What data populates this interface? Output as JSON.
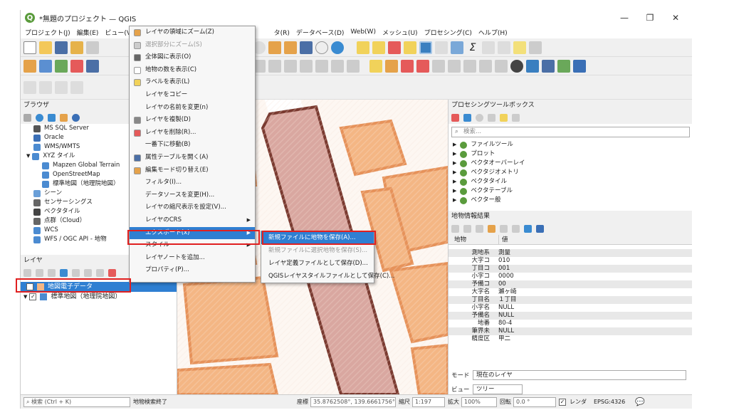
{
  "window": {
    "title": "*無題のプロジェクト — QGIS",
    "controls": [
      "—",
      "❐",
      "✕"
    ]
  },
  "menubar": [
    "プロジェクト(J)",
    "編集(E)",
    "ビュー(V)",
    "レイ",
    "タ(R)",
    "データベース(D)",
    "Web(W)",
    "メッシュ(U)",
    "プロセシング(C)",
    "ヘルプ(H)"
  ],
  "browser": {
    "title": "ブラウザ",
    "items": [
      {
        "label": "MS SQL Server",
        "indent": 1,
        "icon": "mssql-icon",
        "color": "#555"
      },
      {
        "label": "Oracle",
        "indent": 1,
        "icon": "oracle-icon",
        "color": "#3b6fb6"
      },
      {
        "label": "WMS/WMTS",
        "indent": 1,
        "icon": "globe-icon",
        "color": "#4b8bd1"
      },
      {
        "label": "XYZ タイル",
        "indent": 0,
        "icon": "grid-icon",
        "color": "#4b8bd1"
      },
      {
        "label": "Mapzen Global Terrain",
        "indent": 2,
        "icon": "grid-icon",
        "color": "#4b8bd1"
      },
      {
        "label": "OpenStreetMap",
        "indent": 2,
        "icon": "grid-icon",
        "color": "#4b8bd1"
      },
      {
        "label": "標準地図（地理院地図）",
        "indent": 2,
        "icon": "grid-icon",
        "color": "#4b8bd1"
      },
      {
        "label": "シーン",
        "indent": 1,
        "icon": "scene-icon",
        "color": "#6a9fd8"
      },
      {
        "label": "センサーシングス",
        "indent": 1,
        "icon": "sensor-icon",
        "color": "#666"
      },
      {
        "label": "ベクタタイル",
        "indent": 1,
        "icon": "vectortile-icon",
        "color": "#444"
      },
      {
        "label": "点群（Cloud）",
        "indent": 1,
        "icon": "pointcloud-icon",
        "color": "#666"
      },
      {
        "label": "WCS",
        "indent": 1,
        "icon": "globe-icon",
        "color": "#4b8bd1"
      },
      {
        "label": "WFS / OGC API - 地物",
        "indent": 1,
        "icon": "globe-icon",
        "color": "#4b8bd1"
      }
    ]
  },
  "layers": {
    "title": "レイヤ",
    "items": [
      {
        "label": "地図電子データ",
        "checked": true,
        "selected": true
      },
      {
        "label": "標準地図（地理院地図）",
        "checked": true,
        "selected": false
      }
    ]
  },
  "context_menu": {
    "items": [
      {
        "label": "レイヤの領域にズーム(Z)",
        "disabled": false,
        "icon": "zoom-layer-icon"
      },
      {
        "label": "選択部分にズーム(S)",
        "disabled": true,
        "icon": "zoom-selection-icon"
      },
      {
        "label": "全体図に表示(O)",
        "disabled": false,
        "icon": "overview-icon"
      },
      {
        "label": "地物の数を表示(C)",
        "disabled": false,
        "icon": "checkbox-icon"
      },
      {
        "label": "ラベルを表示(L)",
        "disabled": false,
        "icon": "label-icon"
      },
      {
        "label": "レイヤをコピー",
        "disabled": false,
        "icon": ""
      },
      {
        "label": "レイヤの名前を変更(n)",
        "disabled": false,
        "icon": ""
      },
      {
        "label": "レイヤを複製(D)",
        "disabled": false,
        "icon": "duplicate-icon"
      },
      {
        "label": "レイヤを削除(R)...",
        "disabled": false,
        "icon": "remove-icon"
      },
      {
        "label": "一番下に移動(B)",
        "disabled": false,
        "icon": ""
      },
      {
        "label": "属性テーブルを開く(A)",
        "disabled": false,
        "icon": "table-icon"
      },
      {
        "label": "編集モード切り替え(E)",
        "disabled": false,
        "icon": "pencil-icon"
      },
      {
        "label": "フィルタ(I)...",
        "disabled": false,
        "icon": ""
      },
      {
        "label": "データソースを変更(H)...",
        "disabled": false,
        "icon": ""
      },
      {
        "label": "レイヤの縮尺表示を設定(V)...",
        "disabled": false,
        "icon": ""
      },
      {
        "label": "レイヤのCRS",
        "disabled": false,
        "icon": "",
        "submenu": true
      },
      {
        "label": "エクスポート(x)",
        "disabled": false,
        "icon": "",
        "submenu": true,
        "selected": true
      },
      {
        "label": "スタイル",
        "disabled": false,
        "icon": "",
        "submenu": true
      },
      {
        "label": "レイヤノートを追加...",
        "disabled": false,
        "icon": ""
      },
      {
        "label": "プロパティ(P)...",
        "disabled": false,
        "icon": ""
      }
    ]
  },
  "export_submenu": {
    "items": [
      {
        "label": "新規ファイルに地物を保存(A)...",
        "selected": true,
        "disabled": false
      },
      {
        "label": "新規ファイルに選択地物を保存(S)...",
        "selected": false,
        "disabled": true
      },
      {
        "label": "レイヤ定義ファイルとして保存(D)...",
        "selected": false,
        "disabled": false
      },
      {
        "label": "QGISレイヤスタイルファイルとして保存(C)...",
        "selected": false,
        "disabled": false
      }
    ]
  },
  "processing": {
    "title": "プロセシングツールボックス",
    "search_placeholder": "検索...",
    "items": [
      "ファイルツール",
      "プロット",
      "ベクタオーバーレイ",
      "ベクタジオメトリ",
      "ベクタタイル",
      "ベクタテーブル",
      "ベクター般"
    ]
  },
  "identify": {
    "title": "地物情報結果",
    "col_feature": "地物",
    "col_value": "値",
    "rows": [
      {
        "k": "測地系",
        "v": "測量"
      },
      {
        "k": "大字コ",
        "v": "010"
      },
      {
        "k": "丁目コ",
        "v": "001"
      },
      {
        "k": "小字コ",
        "v": "0000"
      },
      {
        "k": "予備コ",
        "v": "00"
      },
      {
        "k": "大字名",
        "v": "瀬ヶ崎"
      },
      {
        "k": "丁目名",
        "v": "１丁目"
      },
      {
        "k": "小字名",
        "v": "NULL"
      },
      {
        "k": "予備名",
        "v": "NULL"
      },
      {
        "k": "地番",
        "v": "80-4"
      },
      {
        "k": "筆界未",
        "v": "NULL"
      },
      {
        "k": "精度区",
        "v": "甲二"
      }
    ],
    "mode_label": "モード",
    "mode_value": "現在のレイヤ",
    "view_label": "ビュー",
    "view_value": "ツリー"
  },
  "statusbar": {
    "search_placeholder": "検索 (Ctrl + K)",
    "message": "地物検索終了",
    "coord_label": "座標",
    "coord_value": "35.8762508°, 139.6661756°",
    "scale_label": "縮尺",
    "scale_value": "1:197",
    "magnifier_label": "拡大",
    "magnifier_value": "100%",
    "rotation_label": "回転",
    "rotation_value": "0.0 °",
    "render_label": "レンダ",
    "crs": "EPSG:4326"
  },
  "colors": {
    "selection": "#2f7fd2",
    "highlight_box": "#e02020",
    "parcel_fill": "#d9a7a0",
    "parcel_stroke": "#7a3a30",
    "building": "#f4b684"
  }
}
